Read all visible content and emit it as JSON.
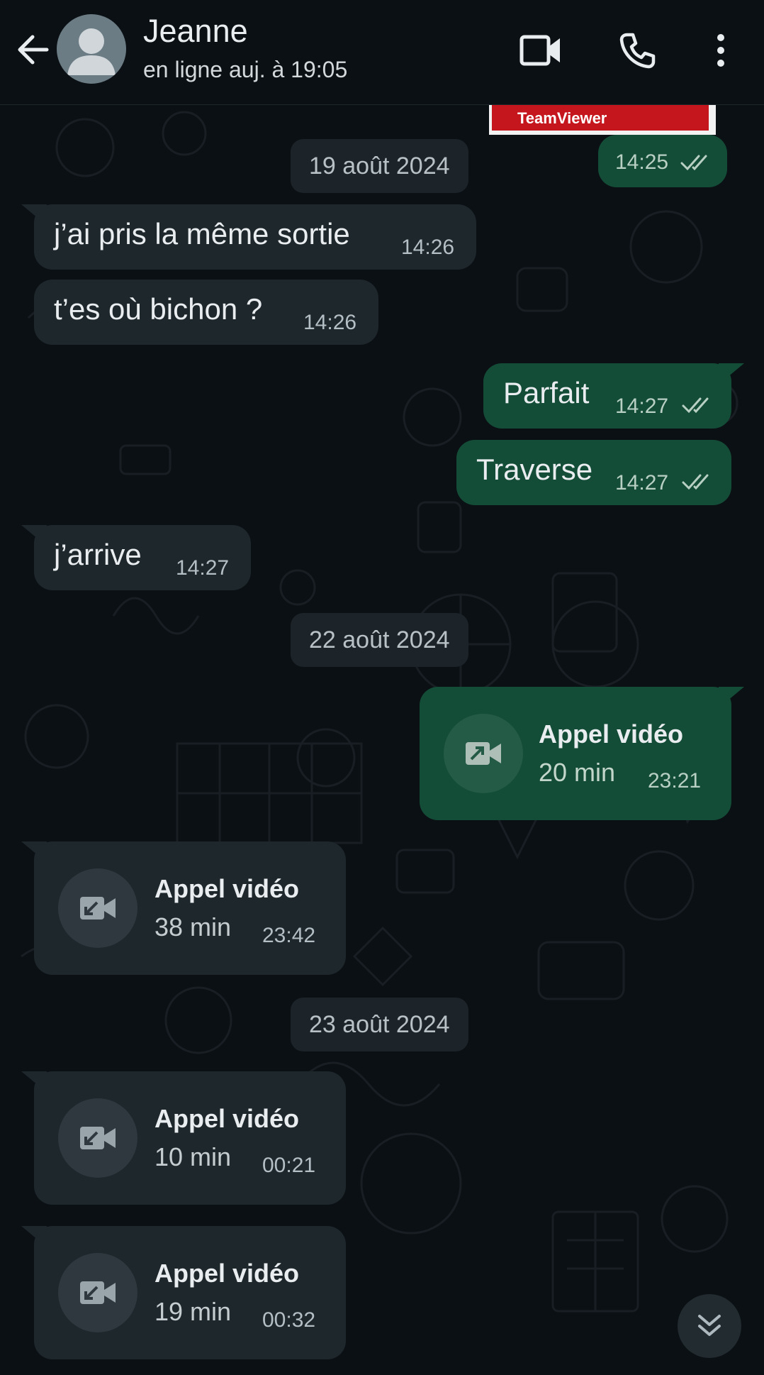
{
  "header": {
    "contact_name": "Jeanne",
    "status": "en ligne auj. à 19:05",
    "icons": [
      "back-arrow-icon",
      "avatar-placeholder-icon",
      "video-call-icon",
      "phone-icon",
      "more-vert-icon"
    ]
  },
  "image_peek": {
    "brand_text": "TeamViewer"
  },
  "messages": {
    "img_time": "14:25",
    "date1": "19 août 2024",
    "m1": {
      "text": "j’ai pris la même sortie",
      "time": "14:26"
    },
    "m2": {
      "text": "t’es où bichon ?",
      "time": "14:26"
    },
    "m3": {
      "text": "Parfait",
      "time": "14:27"
    },
    "m4": {
      "text": "Traverse",
      "time": "14:27"
    },
    "m5": {
      "text": "j’arrive",
      "time": "14:27"
    },
    "date2": "22 août 2024",
    "call1": {
      "title": "Appel vidéo",
      "duration": "20 min",
      "time": "23:21"
    },
    "call2": {
      "title": "Appel vidéo",
      "duration": "38 min",
      "time": "23:42"
    },
    "date3": "23 août 2024",
    "call3": {
      "title": "Appel vidéo",
      "duration": "10 min",
      "time": "00:21"
    },
    "call4": {
      "title": "Appel vidéo",
      "duration": "19 min",
      "time": "00:32"
    }
  },
  "colors": {
    "background": "#0b1014",
    "incoming_bubble": "#1e272c",
    "outgoing_bubble": "#144d37",
    "date_chip": "#1d2429"
  }
}
